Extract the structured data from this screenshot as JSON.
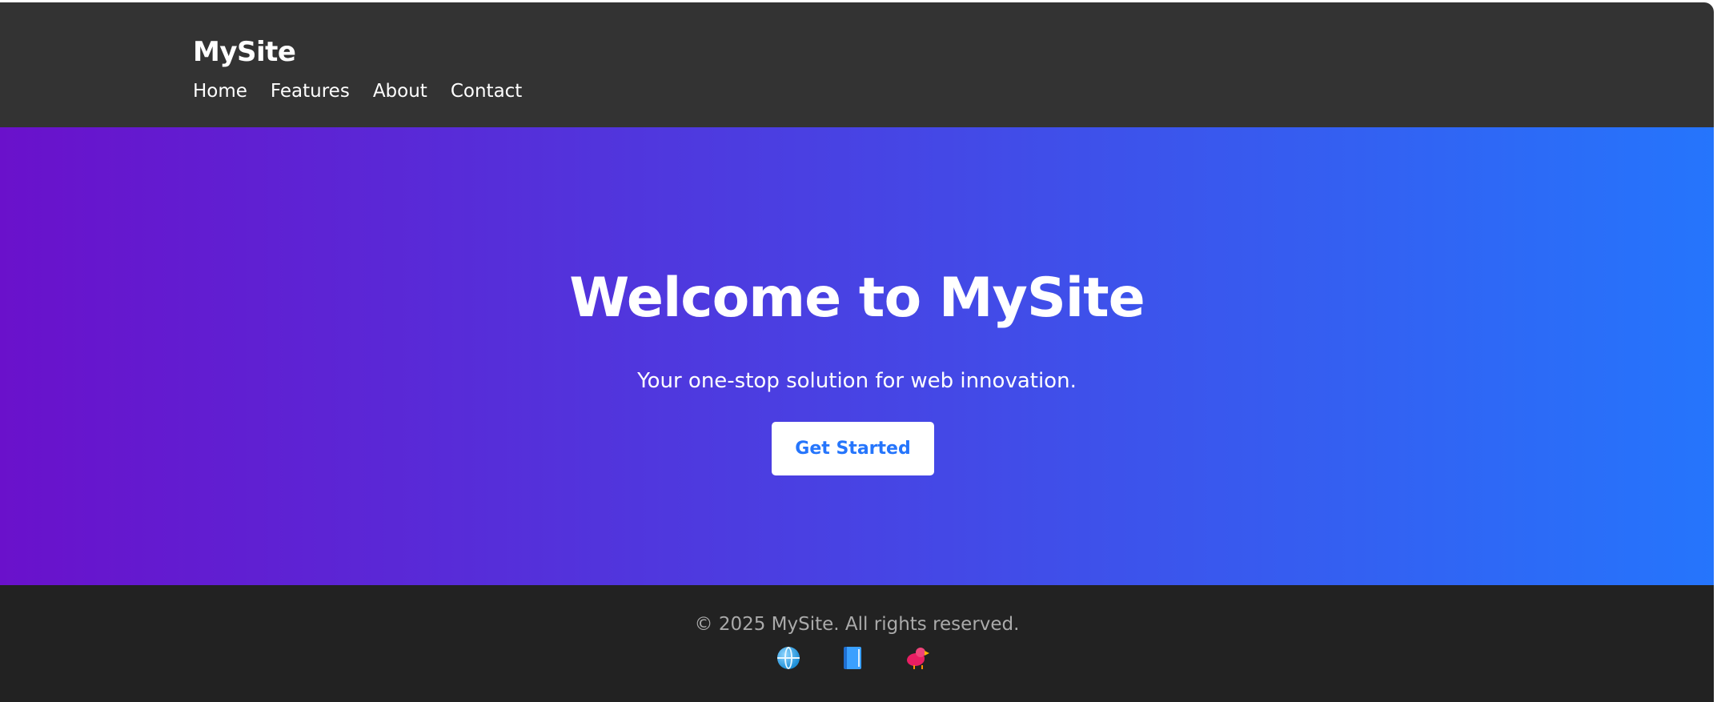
{
  "header": {
    "brand": "MySite",
    "nav": [
      {
        "label": "Home"
      },
      {
        "label": "Features"
      },
      {
        "label": "About"
      },
      {
        "label": "Contact"
      }
    ]
  },
  "hero": {
    "title": "Welcome to MySite",
    "subtitle": "Your one-stop solution for web innovation.",
    "cta_label": "Get Started"
  },
  "footer": {
    "copyright": "© 2025 MySite. All rights reserved.",
    "social_icons": [
      "globe-icon",
      "book-icon",
      "bird-icon"
    ]
  },
  "colors": {
    "header_bg": "#333333",
    "hero_gradient_start": "#6a11cb",
    "hero_gradient_end": "#2575fc",
    "cta_text": "#2575fc",
    "footer_bg": "#222222",
    "footer_text": "#aaaaaa"
  }
}
